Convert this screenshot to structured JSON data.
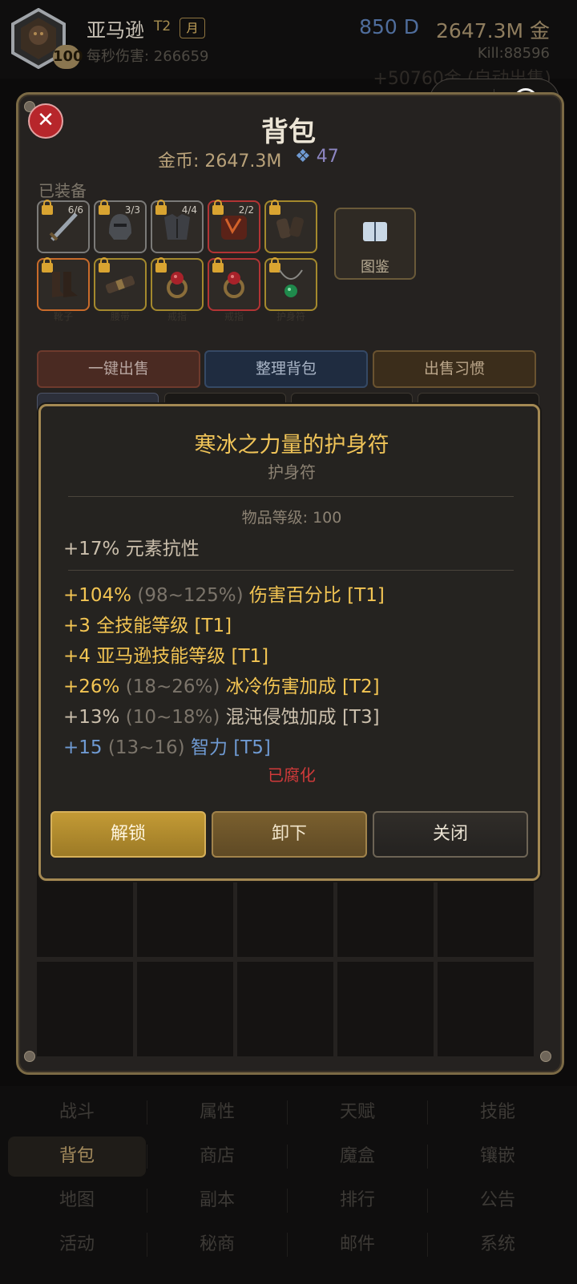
{
  "header": {
    "hero_name": "亚马逊",
    "tier": "T2",
    "month_badge": "月",
    "level": "100",
    "dps": "每秒伤害: 266659",
    "diamonds": "850 D",
    "gold": "2647.3M 金",
    "kills": "Kill:88596",
    "scroll_message": "+50760金 (自动出售)"
  },
  "backpack": {
    "title": "背包",
    "gold": "金币: 2647.3M",
    "gems": "47",
    "equipped_label": "已装备",
    "codex_label": "图鉴",
    "slots": [
      {
        "count": "6/6",
        "label": "",
        "border": "gray",
        "icon": "sword-icon"
      },
      {
        "count": "3/3",
        "label": "",
        "border": "gray",
        "icon": "helmet-icon"
      },
      {
        "count": "4/4",
        "label": "",
        "border": "gray",
        "icon": "armor-icon"
      },
      {
        "count": "2/2",
        "label": "",
        "border": "red",
        "icon": "gloves-icon"
      },
      {
        "count": "",
        "label": "",
        "border": "gold",
        "icon": "bracers-icon"
      },
      {
        "count": "",
        "label": "靴子",
        "border": "orange",
        "icon": "boots-icon"
      },
      {
        "count": "",
        "label": "腰带",
        "border": "gold",
        "icon": "belt-icon"
      },
      {
        "count": "",
        "label": "戒指",
        "border": "gold",
        "icon": "ring-icon"
      },
      {
        "count": "",
        "label": "戒指",
        "border": "red",
        "icon": "ring-icon"
      },
      {
        "count": "",
        "label": "护身符",
        "border": "gold",
        "icon": "amulet-icon"
      }
    ],
    "actions": {
      "sell_all": "一键出售",
      "sort": "整理背包",
      "sell_habit": "出售习惯"
    }
  },
  "tooltip": {
    "title": "寒冰之力量的护身符",
    "type": "护身符",
    "item_level": "物品等级: 100",
    "implicit": "+17% 元素抗性",
    "affixes": [
      {
        "value": "+104%",
        "range": "(98~125%)",
        "name": "伤害百分比 [T1]",
        "color": "gold"
      },
      {
        "value": "+3",
        "range": "",
        "name": "全技能等级 [T1]",
        "color": "gold"
      },
      {
        "value": "+4",
        "range": "",
        "name": "亚马逊技能等级 [T1]",
        "color": "gold"
      },
      {
        "value": "+26%",
        "range": "(18~26%)",
        "name": "冰冷伤害加成 [T2]",
        "color": "gold"
      },
      {
        "value": "+13%",
        "range": "(10~18%)",
        "name": "混沌侵蚀加成 [T3]",
        "color": "tan"
      },
      {
        "value": "+15",
        "range": "(13~16)",
        "name": "智力 [T5]",
        "color": "blue"
      }
    ],
    "corrupted": "已腐化",
    "buttons": {
      "unlock": "解锁",
      "unequip": "卸下",
      "close": "关闭"
    }
  },
  "nav": {
    "items": [
      "战斗",
      "属性",
      "天赋",
      "技能",
      "背包",
      "商店",
      "魔盒",
      "镶嵌",
      "地图",
      "副本",
      "排行",
      "公告",
      "活动",
      "秘商",
      "邮件",
      "系统"
    ],
    "active": "背包"
  },
  "colors": {
    "gold_text": "#f3c553",
    "panel_border": "#7b6a45",
    "corrupted": "#d03a3a",
    "magic_blue": "#6f9ad2"
  }
}
